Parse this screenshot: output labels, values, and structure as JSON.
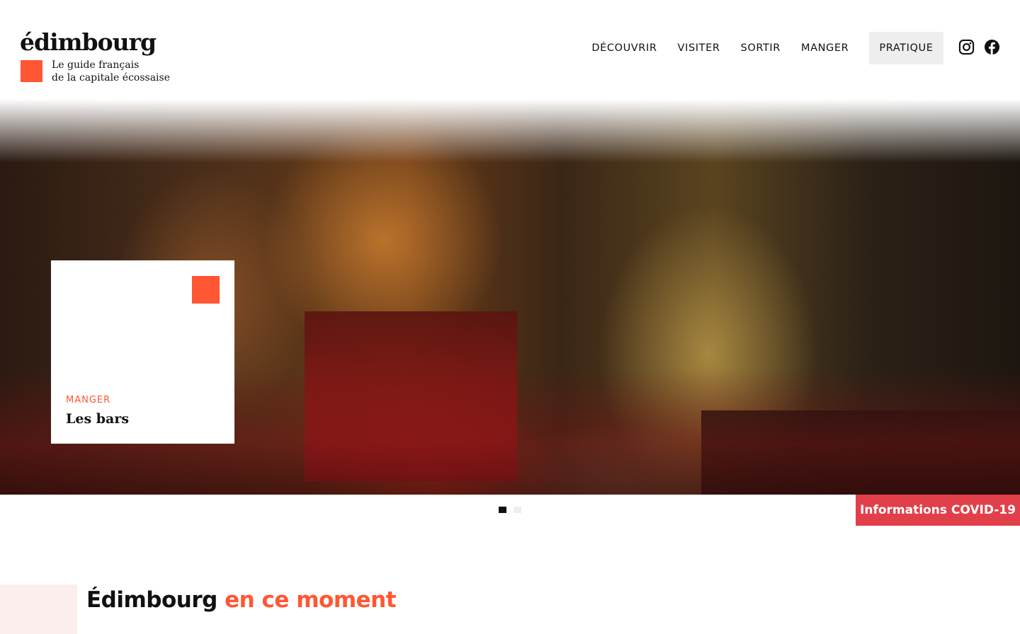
{
  "header": {
    "logo": "édimbourg",
    "tagline_line1": "Le guide français",
    "tagline_line2": "de la capitale écossaise",
    "nav": [
      {
        "label": "DÉCOUVRIR"
      },
      {
        "label": "VISITER"
      },
      {
        "label": "SORTIR"
      },
      {
        "label": "MANGER"
      },
      {
        "label": "PRATIQUE",
        "active": true
      }
    ],
    "social": [
      "instagram-icon",
      "facebook-icon"
    ]
  },
  "hero": {
    "card_category": "MANGER",
    "card_title": "Les bars",
    "slides_count": 2,
    "active_slide": 1
  },
  "covid_button": "Informations COVID-19",
  "section": {
    "title_part1": "Édimbourg",
    "title_part2": "en ce moment"
  },
  "colors": {
    "accent": "#ff5733",
    "covid": "#e1404a",
    "nav_active_bg": "#eeeeee"
  }
}
